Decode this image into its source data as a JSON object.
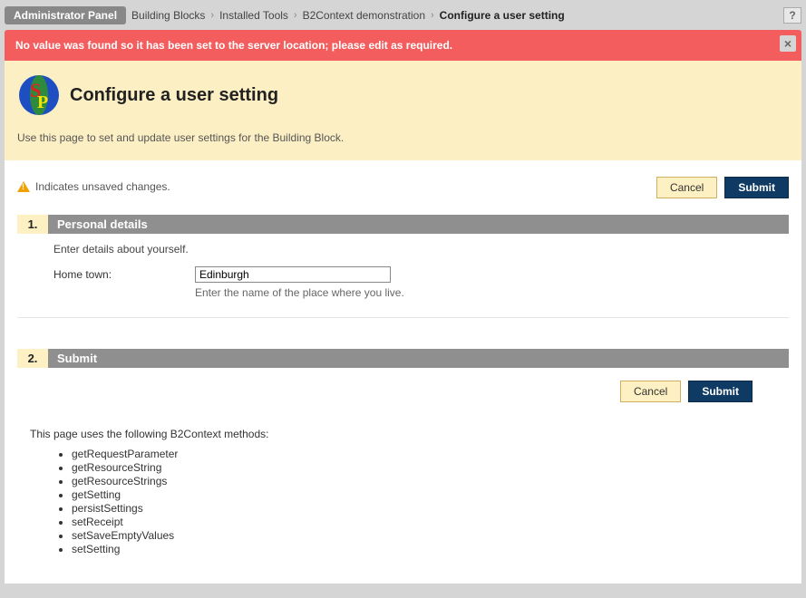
{
  "breadcrumb": {
    "first": "Administrator Panel",
    "items": [
      "Building Blocks",
      "Installed Tools",
      "B2Context demonstration"
    ],
    "current": "Configure a user setting"
  },
  "help_label": "?",
  "alert": {
    "message": "No value was found so it has been set to the server location; please edit as required.",
    "close_label": "×"
  },
  "header": {
    "title": "Configure a user setting",
    "description": "Use this page to set and update user settings for the Building Block."
  },
  "unsaved_note": "Indicates unsaved changes.",
  "buttons": {
    "cancel": "Cancel",
    "submit": "Submit"
  },
  "sections": {
    "s1": {
      "num": "1.",
      "title": "Personal details",
      "intro": "Enter details about yourself.",
      "field_label": "Home town:",
      "field_value": "Edinburgh",
      "field_hint": "Enter the name of the place where you live."
    },
    "s2": {
      "num": "2.",
      "title": "Submit"
    }
  },
  "methods_intro": "This page uses the following B2Context methods:",
  "methods": [
    "getRequestParameter",
    "getResourceString",
    "getResourceStrings",
    "getSetting",
    "persistSettings",
    "setReceipt",
    "setSaveEmptyValues",
    "setSetting"
  ]
}
